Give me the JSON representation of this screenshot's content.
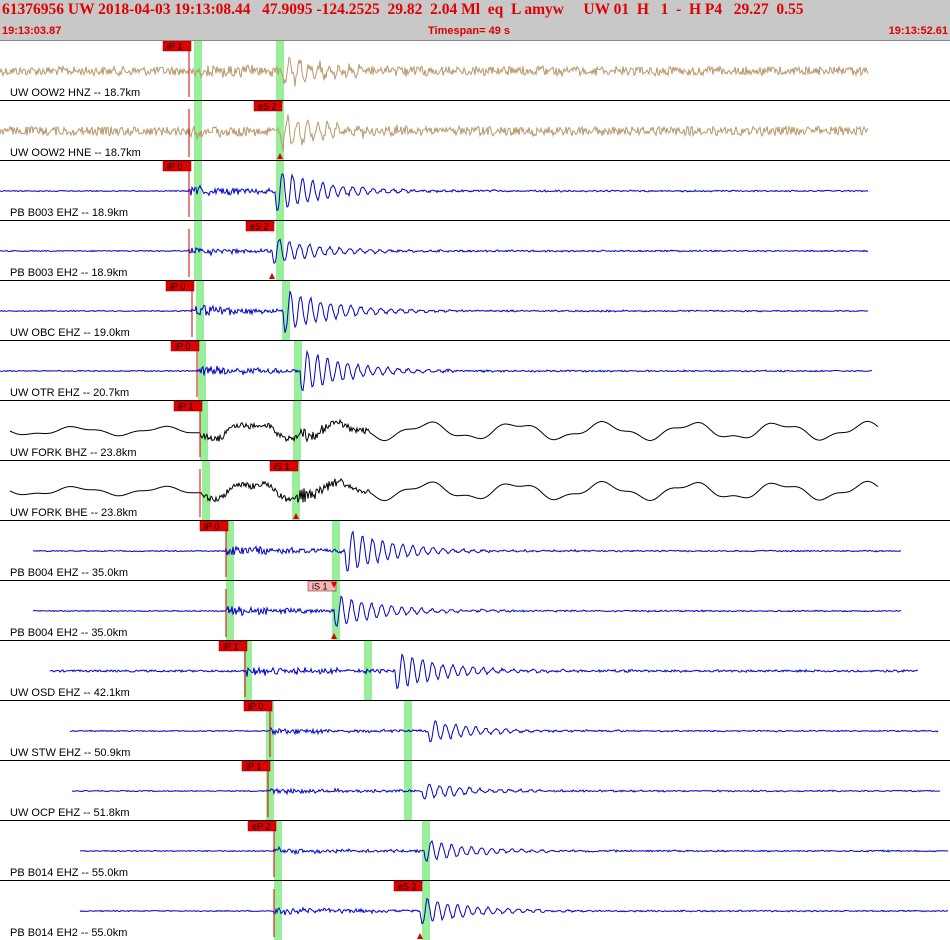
{
  "header": {
    "event_line": "61376956 UW 2018-04-03 19:13:08.44   47.9095 -124.2525  29.82  2.04 Ml  eq  L amyw     UW 01  H   1  -  H P4   29.27  0.55",
    "start_time": "19:13:03.87",
    "end_time": "19:13:52.61",
    "timespan": "Timespan=  49 s"
  },
  "colors": {
    "header_bg": "#c8c8c8",
    "header_text": "#e00000",
    "trace_hn": "#b8986a",
    "trace_eh": "#0000cc",
    "trace_bh": "#000000",
    "pick_bg": "#e00000",
    "pick_bg_light": "#f4b8b8",
    "window_green": "#99ee99"
  },
  "traces": [
    {
      "label": "UW OOW2 HNZ -- 18.7km",
      "color": "hn",
      "start": 0,
      "end": 868,
      "p_onset": 189,
      "s_onset": 282,
      "amp": 9,
      "post_amp": 10,
      "lf": false,
      "pick": {
        "text": "iP 1",
        "style": "dark"
      },
      "green": [
        194,
        276
      ]
    },
    {
      "label": "UW OOW2 HNE -- 18.7km",
      "color": "hn",
      "start": 0,
      "end": 868,
      "p_onset": 189,
      "s_onset": 280,
      "amp": 9,
      "post_amp": 12,
      "lf": false,
      "pick": {
        "text": "eS 2",
        "style": "dark"
      },
      "green": [
        194,
        276
      ]
    },
    {
      "label": "PB B003 EHZ -- 18.9km",
      "color": "eh",
      "start": 0,
      "end": 868,
      "p_onset": 189,
      "s_onset": 275,
      "amp": 1,
      "post_amp": 16,
      "lf": false,
      "pick": {
        "text": "iP 0",
        "style": "dark"
      },
      "green": [
        194,
        276
      ]
    },
    {
      "label": "PB B003 EH2 -- 18.9km",
      "color": "eh",
      "start": 0,
      "end": 868,
      "p_onset": 189,
      "s_onset": 272,
      "amp": 1,
      "post_amp": 10,
      "lf": false,
      "pick": {
        "text": "eS 2",
        "style": "dark"
      },
      "green": [
        194,
        276
      ]
    },
    {
      "label": "UW OBC EHZ -- 19.0km",
      "color": "eh",
      "start": 0,
      "end": 868,
      "p_onset": 192,
      "s_onset": 283,
      "amp": 1,
      "post_amp": 16,
      "lf": false,
      "pick": {
        "text": "iP 0",
        "style": "dark"
      },
      "green": [
        196,
        282
      ]
    },
    {
      "label": "UW OTR EHZ -- 20.7km",
      "color": "eh",
      "start": 0,
      "end": 872,
      "p_onset": 197,
      "s_onset": 300,
      "amp": 1,
      "post_amp": 16,
      "lf": false,
      "pick": {
        "text": "iP 0",
        "style": "dark"
      },
      "green": [
        198,
        294
      ]
    },
    {
      "label": "UW FORK BHZ -- 23.8km",
      "color": "bh",
      "start": 10,
      "end": 878,
      "p_onset": 200,
      "s_onset": 300,
      "amp": 10,
      "post_amp": 12,
      "lf": true,
      "pick": {
        "text": "iP 1",
        "style": "dark"
      },
      "green": [
        200,
        293
      ]
    },
    {
      "label": "UW FORK BHE -- 23.8km",
      "color": "bh",
      "start": 10,
      "end": 878,
      "p_onset": 200,
      "s_onset": 296,
      "amp": 6,
      "post_amp": 12,
      "lf": true,
      "pick": {
        "text": "iS 1",
        "style": "dark"
      },
      "green": [
        202,
        292
      ]
    },
    {
      "label": "PB B004 EHZ -- 35.0km",
      "color": "eh",
      "start": 33,
      "end": 901,
      "p_onset": 226,
      "s_onset": 345,
      "amp": 1,
      "post_amp": 16,
      "lf": false,
      "pick": {
        "text": "iP 0",
        "style": "dark"
      },
      "green": [
        226,
        332
      ]
    },
    {
      "label": "PB B004 EH2 -- 35.0km",
      "color": "eh",
      "start": 33,
      "end": 901,
      "p_onset": 226,
      "s_onset": 334,
      "amp": 1,
      "post_amp": 12,
      "lf": false,
      "pick": {
        "text": "iS 1",
        "style": "light"
      },
      "green": [
        226,
        332
      ]
    },
    {
      "label": "UW OSD EHZ -- 42.1km",
      "color": "eh",
      "start": 50,
      "end": 918,
      "p_onset": 245,
      "s_onset": 395,
      "amp": 2,
      "post_amp": 14,
      "lf": false,
      "pick": {
        "text": "iP 1",
        "style": "dark"
      },
      "green": [
        244,
        364
      ]
    },
    {
      "label": "UW STW EHZ -- 50.9km",
      "color": "eh",
      "start": 70,
      "end": 938,
      "p_onset": 270,
      "s_onset": 428,
      "amp": 1,
      "post_amp": 8,
      "lf": false,
      "pick": {
        "text": "iP 0",
        "style": "dark"
      },
      "green": [
        266,
        404
      ]
    },
    {
      "label": "UW OCP EHZ -- 51.8km",
      "color": "eh",
      "start": 72,
      "end": 940,
      "p_onset": 268,
      "s_onset": 422,
      "amp": 1,
      "post_amp": 6,
      "lf": false,
      "pick": {
        "text": "iP 1",
        "style": "dark"
      },
      "green": [
        266,
        404
      ]
    },
    {
      "label": "PB B014 EHZ -- 55.0km",
      "color": "eh",
      "start": 80,
      "end": 948,
      "p_onset": 274,
      "s_onset": 424,
      "amp": 1,
      "post_amp": 8,
      "lf": false,
      "pick": {
        "text": "eP 2",
        "style": "dark"
      },
      "green": [
        274,
        422
      ]
    },
    {
      "label": "PB B014 EH2 -- 55.0km",
      "color": "eh",
      "start": 80,
      "end": 948,
      "p_onset": 274,
      "s_onset": 420,
      "amp": 1,
      "post_amp": 10,
      "lf": false,
      "pick": {
        "text": "eS 2",
        "style": "dark"
      },
      "green": [
        274,
        422
      ]
    }
  ]
}
